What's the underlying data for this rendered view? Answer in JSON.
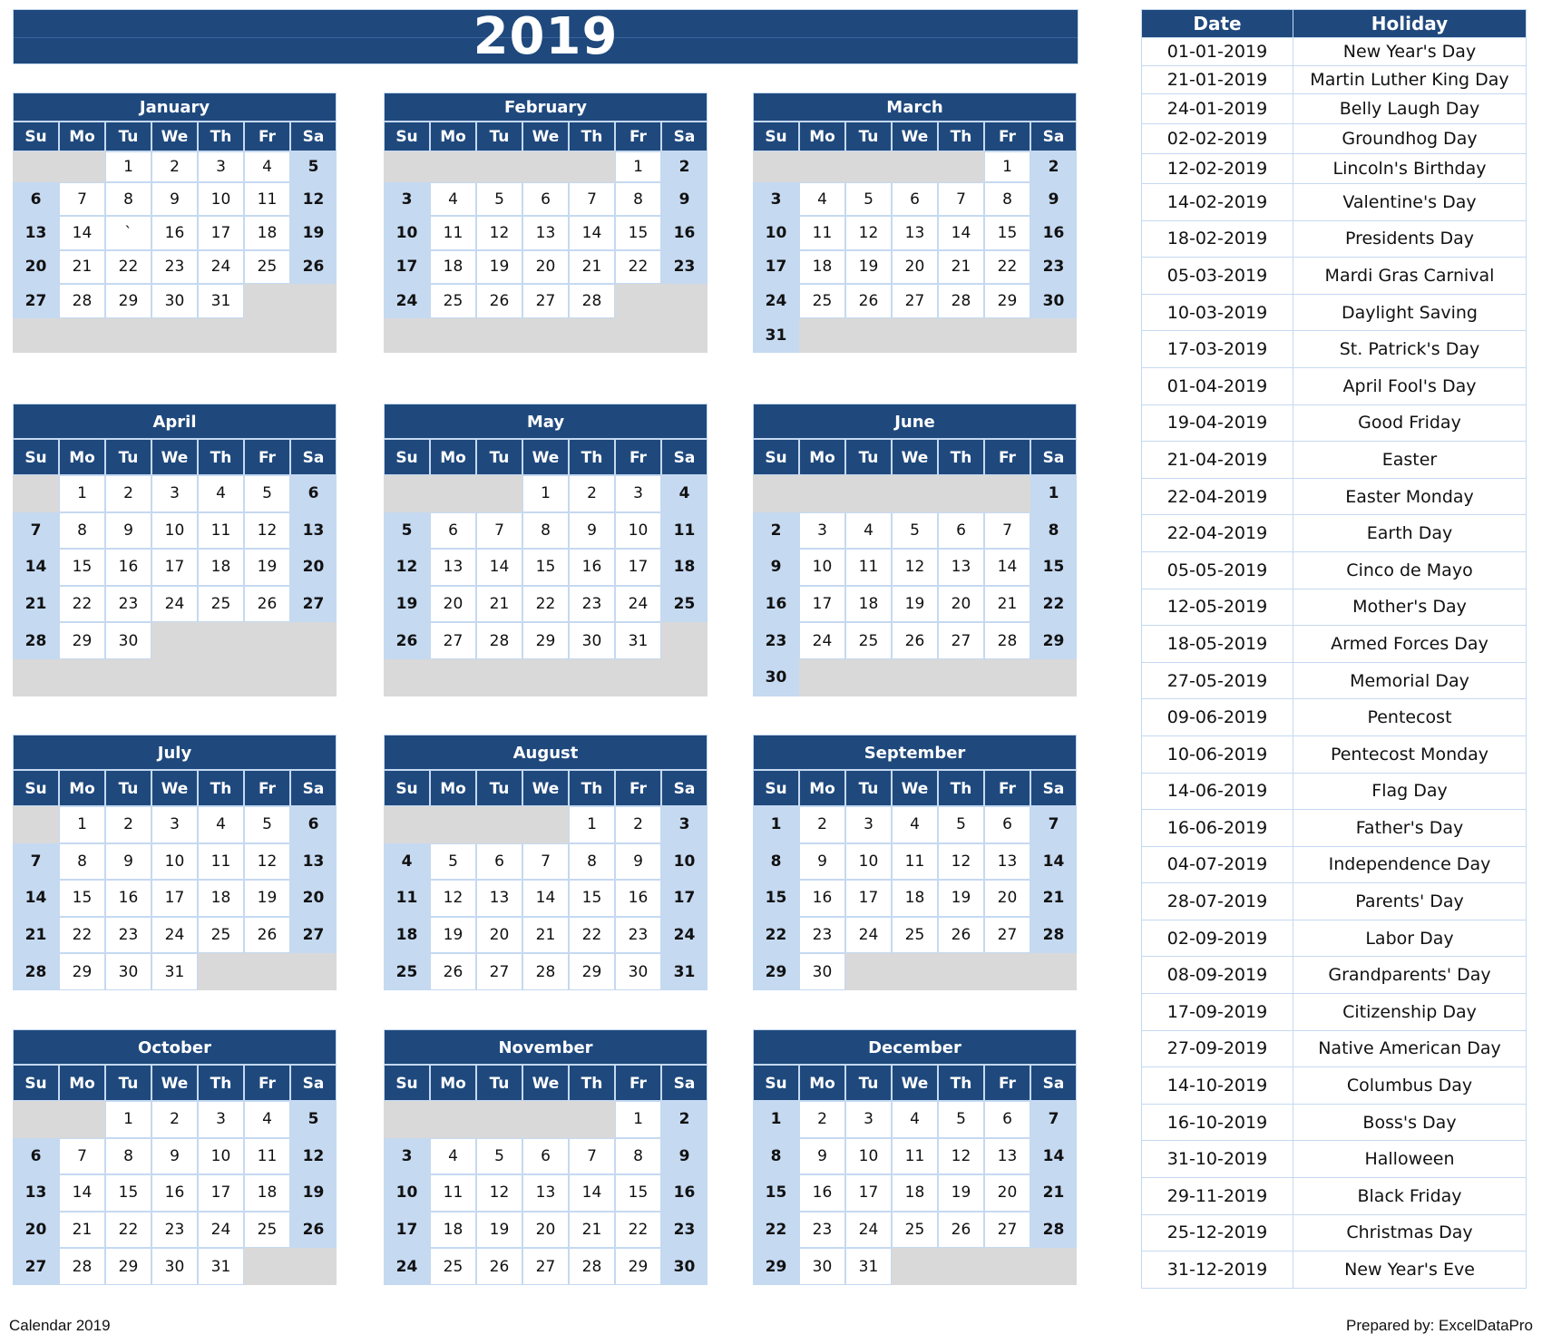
{
  "title": {
    "year": "2019"
  },
  "colors": {
    "header": "#1f497d",
    "weekend": "#c5d9f1",
    "empty": "#d9d9d9",
    "border": "#c5d9f1"
  },
  "weekday_labels": [
    "Su",
    "Mo",
    "Tu",
    "We",
    "Th",
    "Fr",
    "Sa"
  ],
  "months": [
    {
      "name": "January",
      "weeks": [
        [
          "",
          "",
          "1",
          "2",
          "3",
          "4",
          "5"
        ],
        [
          "6",
          "7",
          "8",
          "9",
          "10",
          "11",
          "12"
        ],
        [
          "13",
          "14",
          "`",
          "16",
          "17",
          "18",
          "19"
        ],
        [
          "20",
          "21",
          "22",
          "23",
          "24",
          "25",
          "26"
        ],
        [
          "27",
          "28",
          "29",
          "30",
          "31",
          "",
          ""
        ],
        [
          "",
          "",
          "",
          "",
          "",
          "",
          ""
        ]
      ]
    },
    {
      "name": "February",
      "weeks": [
        [
          "",
          "",
          "",
          "",
          "",
          "1",
          "2"
        ],
        [
          "3",
          "4",
          "5",
          "6",
          "7",
          "8",
          "9"
        ],
        [
          "10",
          "11",
          "12",
          "13",
          "14",
          "15",
          "16"
        ],
        [
          "17",
          "18",
          "19",
          "20",
          "21",
          "22",
          "23"
        ],
        [
          "24",
          "25",
          "26",
          "27",
          "28",
          "",
          ""
        ],
        [
          "",
          "",
          "",
          "",
          "",
          "",
          ""
        ]
      ]
    },
    {
      "name": "March",
      "weeks": [
        [
          "",
          "",
          "",
          "",
          "",
          "1",
          "2"
        ],
        [
          "3",
          "4",
          "5",
          "6",
          "7",
          "8",
          "9"
        ],
        [
          "10",
          "11",
          "12",
          "13",
          "14",
          "15",
          "16"
        ],
        [
          "17",
          "18",
          "19",
          "20",
          "21",
          "22",
          "23"
        ],
        [
          "24",
          "25",
          "26",
          "27",
          "28",
          "29",
          "30"
        ],
        [
          "31",
          "",
          "",
          "",
          "",
          "",
          ""
        ]
      ]
    },
    {
      "name": "April",
      "weeks": [
        [
          "",
          "1",
          "2",
          "3",
          "4",
          "5",
          "6"
        ],
        [
          "7",
          "8",
          "9",
          "10",
          "11",
          "12",
          "13"
        ],
        [
          "14",
          "15",
          "16",
          "17",
          "18",
          "19",
          "20"
        ],
        [
          "21",
          "22",
          "23",
          "24",
          "25",
          "26",
          "27"
        ],
        [
          "28",
          "29",
          "30",
          "",
          "",
          "",
          ""
        ],
        [
          "",
          "",
          "",
          "",
          "",
          "",
          ""
        ]
      ]
    },
    {
      "name": "May",
      "weeks": [
        [
          "",
          "",
          "",
          "1",
          "2",
          "3",
          "4"
        ],
        [
          "5",
          "6",
          "7",
          "8",
          "9",
          "10",
          "11"
        ],
        [
          "12",
          "13",
          "14",
          "15",
          "16",
          "17",
          "18"
        ],
        [
          "19",
          "20",
          "21",
          "22",
          "23",
          "24",
          "25"
        ],
        [
          "26",
          "27",
          "28",
          "29",
          "30",
          "31",
          ""
        ],
        [
          "",
          "",
          "",
          "",
          "",
          "",
          ""
        ]
      ]
    },
    {
      "name": "June",
      "weeks": [
        [
          "",
          "",
          "",
          "",
          "",
          "",
          "1"
        ],
        [
          "2",
          "3",
          "4",
          "5",
          "6",
          "7",
          "8"
        ],
        [
          "9",
          "10",
          "11",
          "12",
          "13",
          "14",
          "15"
        ],
        [
          "16",
          "17",
          "18",
          "19",
          "20",
          "21",
          "22"
        ],
        [
          "23",
          "24",
          "25",
          "26",
          "27",
          "28",
          "29"
        ],
        [
          "30",
          "",
          "",
          "",
          "",
          "",
          ""
        ]
      ]
    },
    {
      "name": "July",
      "weeks": [
        [
          "",
          "1",
          "2",
          "3",
          "4",
          "5",
          "6"
        ],
        [
          "7",
          "8",
          "9",
          "10",
          "11",
          "12",
          "13"
        ],
        [
          "14",
          "15",
          "16",
          "17",
          "18",
          "19",
          "20"
        ],
        [
          "21",
          "22",
          "23",
          "24",
          "25",
          "26",
          "27"
        ],
        [
          "28",
          "29",
          "30",
          "31",
          "",
          "",
          ""
        ]
      ]
    },
    {
      "name": "August",
      "weeks": [
        [
          "",
          "",
          "",
          "",
          "1",
          "2",
          "3"
        ],
        [
          "4",
          "5",
          "6",
          "7",
          "8",
          "9",
          "10"
        ],
        [
          "11",
          "12",
          "13",
          "14",
          "15",
          "16",
          "17"
        ],
        [
          "18",
          "19",
          "20",
          "21",
          "22",
          "23",
          "24"
        ],
        [
          "25",
          "26",
          "27",
          "28",
          "29",
          "30",
          "31"
        ]
      ]
    },
    {
      "name": "September",
      "weeks": [
        [
          "1",
          "2",
          "3",
          "4",
          "5",
          "6",
          "7"
        ],
        [
          "8",
          "9",
          "10",
          "11",
          "12",
          "13",
          "14"
        ],
        [
          "15",
          "16",
          "17",
          "18",
          "19",
          "20",
          "21"
        ],
        [
          "22",
          "23",
          "24",
          "25",
          "26",
          "27",
          "28"
        ],
        [
          "29",
          "30",
          "",
          "",
          "",
          "",
          ""
        ]
      ]
    },
    {
      "name": "October",
      "weeks": [
        [
          "",
          "",
          "1",
          "2",
          "3",
          "4",
          "5"
        ],
        [
          "6",
          "7",
          "8",
          "9",
          "10",
          "11",
          "12"
        ],
        [
          "13",
          "14",
          "15",
          "16",
          "17",
          "18",
          "19"
        ],
        [
          "20",
          "21",
          "22",
          "23",
          "24",
          "25",
          "26"
        ],
        [
          "27",
          "28",
          "29",
          "30",
          "31",
          "",
          ""
        ]
      ]
    },
    {
      "name": "November",
      "weeks": [
        [
          "",
          "",
          "",
          "",
          "",
          "1",
          "2"
        ],
        [
          "3",
          "4",
          "5",
          "6",
          "7",
          "8",
          "9"
        ],
        [
          "10",
          "11",
          "12",
          "13",
          "14",
          "15",
          "16"
        ],
        [
          "17",
          "18",
          "19",
          "20",
          "21",
          "22",
          "23"
        ],
        [
          "24",
          "25",
          "26",
          "27",
          "28",
          "29",
          "30"
        ]
      ]
    },
    {
      "name": "December",
      "weeks": [
        [
          "1",
          "2",
          "3",
          "4",
          "5",
          "6",
          "7"
        ],
        [
          "8",
          "9",
          "10",
          "11",
          "12",
          "13",
          "14"
        ],
        [
          "15",
          "16",
          "17",
          "18",
          "19",
          "20",
          "21"
        ],
        [
          "22",
          "23",
          "24",
          "25",
          "26",
          "27",
          "28"
        ],
        [
          "29",
          "30",
          "31",
          "",
          "",
          "",
          ""
        ]
      ]
    }
  ],
  "holidays": {
    "headers": {
      "date": "Date",
      "holiday": "Holiday"
    },
    "rows": [
      {
        "date": "01-01-2019",
        "name": "New Year's Day"
      },
      {
        "date": "21-01-2019",
        "name": "Martin Luther King Day"
      },
      {
        "date": "24-01-2019",
        "name": "Belly Laugh Day"
      },
      {
        "date": "02-02-2019",
        "name": "Groundhog Day"
      },
      {
        "date": "12-02-2019",
        "name": "Lincoln's Birthday"
      },
      {
        "date": "14-02-2019",
        "name": "Valentine's Day"
      },
      {
        "date": "18-02-2019",
        "name": "Presidents Day"
      },
      {
        "date": "05-03-2019",
        "name": "Mardi Gras Carnival"
      },
      {
        "date": "10-03-2019",
        "name": "Daylight Saving"
      },
      {
        "date": "17-03-2019",
        "name": "St. Patrick's Day"
      },
      {
        "date": "01-04-2019",
        "name": "April Fool's Day"
      },
      {
        "date": "19-04-2019",
        "name": "Good Friday"
      },
      {
        "date": "21-04-2019",
        "name": "Easter"
      },
      {
        "date": "22-04-2019",
        "name": "Easter Monday"
      },
      {
        "date": "22-04-2019",
        "name": "Earth Day"
      },
      {
        "date": "05-05-2019",
        "name": "Cinco de Mayo"
      },
      {
        "date": "12-05-2019",
        "name": "Mother's Day"
      },
      {
        "date": "18-05-2019",
        "name": "Armed Forces Day"
      },
      {
        "date": "27-05-2019",
        "name": "Memorial Day"
      },
      {
        "date": "09-06-2019",
        "name": "Pentecost"
      },
      {
        "date": "10-06-2019",
        "name": "Pentecost Monday"
      },
      {
        "date": "14-06-2019",
        "name": "Flag Day"
      },
      {
        "date": "16-06-2019",
        "name": "Father's Day"
      },
      {
        "date": "04-07-2019",
        "name": "Independence Day"
      },
      {
        "date": "28-07-2019",
        "name": "Parents' Day"
      },
      {
        "date": "02-09-2019",
        "name": "Labor Day"
      },
      {
        "date": "08-09-2019",
        "name": "Grandparents' Day"
      },
      {
        "date": "17-09-2019",
        "name": "Citizenship Day"
      },
      {
        "date": "27-09-2019",
        "name": "Native American Day"
      },
      {
        "date": "14-10-2019",
        "name": "Columbus Day"
      },
      {
        "date": "16-10-2019",
        "name": "Boss's Day"
      },
      {
        "date": "31-10-2019",
        "name": "Halloween"
      },
      {
        "date": "29-11-2019",
        "name": "Black Friday"
      },
      {
        "date": "25-12-2019",
        "name": "Christmas Day"
      },
      {
        "date": "31-12-2019",
        "name": "New Year's Eve"
      }
    ]
  },
  "footer": {
    "left": "Calendar 2019",
    "right": "Prepared by: ExcelDataPro"
  }
}
